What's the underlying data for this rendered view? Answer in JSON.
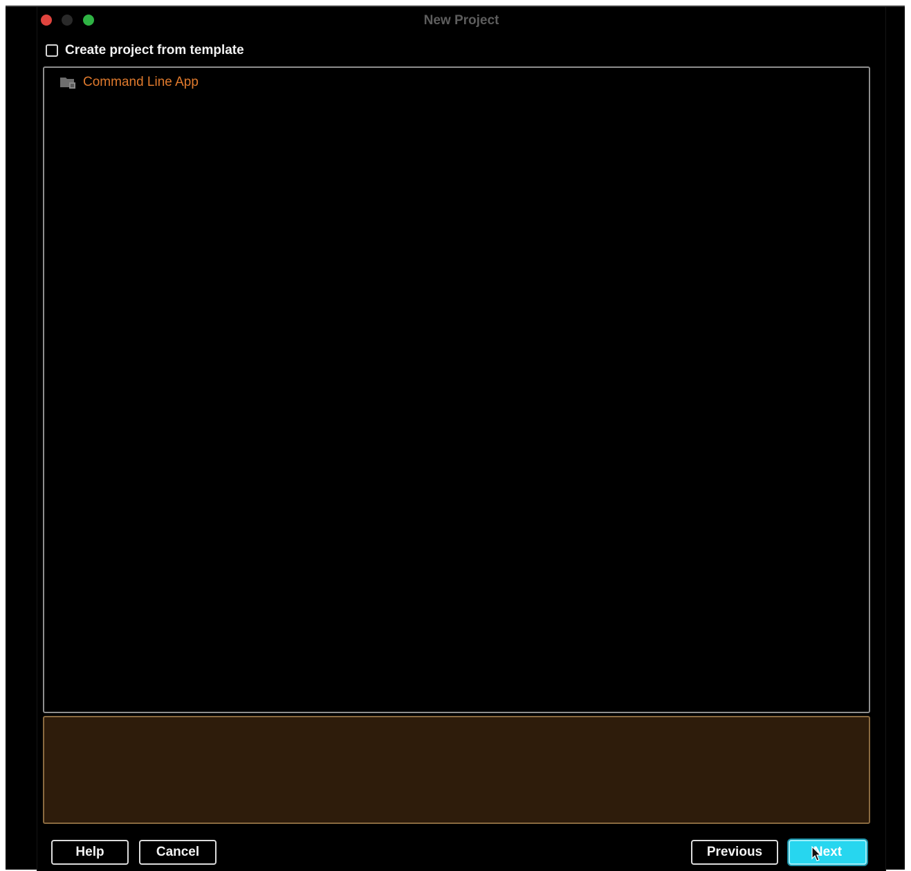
{
  "window": {
    "title": "New Project"
  },
  "template_option": {
    "label": "Create project from template",
    "checked": false
  },
  "templates": [
    {
      "label": "Command Line App",
      "icon": "folder-icon"
    }
  ],
  "buttons": {
    "help": "Help",
    "cancel": "Cancel",
    "previous": "Previous",
    "next": "Next"
  },
  "colors": {
    "selected_item_text": "#e07a2d",
    "description_background": "#2e1c0b",
    "default_button": "#27d6ef"
  }
}
